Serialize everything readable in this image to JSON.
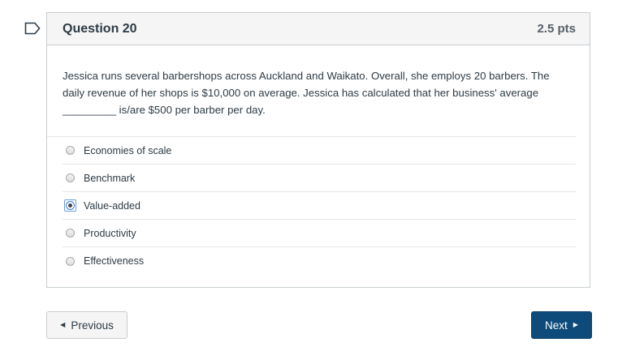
{
  "question": {
    "title": "Question 20",
    "points": "2.5 pts",
    "text": "Jessica runs several barbershops across Auckland and Waikato. Overall, she employs 20 barbers. The daily revenue of her shops is $10,000 on average. Jessica has calculated that her business' average _________ is/are $500 per barber per day."
  },
  "answers": [
    {
      "label": "Economies of scale",
      "selected": false
    },
    {
      "label": "Benchmark",
      "selected": false
    },
    {
      "label": "Value-added",
      "selected": true
    },
    {
      "label": "Productivity",
      "selected": false
    },
    {
      "label": "Effectiveness",
      "selected": false
    }
  ],
  "nav": {
    "previous_label": "Previous",
    "next_label": "Next"
  },
  "colors": {
    "next_button": "#0e4a7a",
    "border": "#c7cdd1",
    "header_bg": "#f5f5f5"
  },
  "icons": {
    "bookmark": "bookmark-outline-icon",
    "prev_caret": "caret-left-icon",
    "next_caret": "caret-right-icon"
  }
}
